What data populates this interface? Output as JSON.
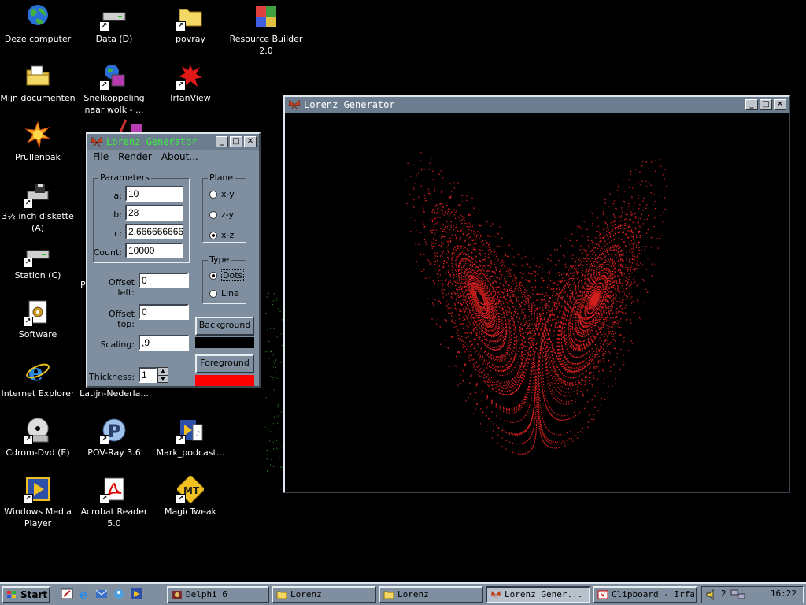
{
  "desktop": {
    "icons": [
      {
        "label": "Deze computer"
      },
      {
        "label": "Mijn documenten"
      },
      {
        "label": "Prullenbak"
      },
      {
        "label": "3½ inch diskette (A)"
      },
      {
        "label": "Station (C)"
      },
      {
        "label": "Software"
      },
      {
        "label": "Internet Explorer"
      },
      {
        "label": "Cdrom-Dvd (E)"
      },
      {
        "label": "Windows Media Player"
      },
      {
        "label": "Data (D)"
      },
      {
        "label": "Snelkoppeling naar wolk - ..."
      },
      {
        "label": "Latijn-Nederla..."
      },
      {
        "label": "POV-Ray 3.6"
      },
      {
        "label": "Acrobat Reader 5.0"
      },
      {
        "label": "povray"
      },
      {
        "label": "IrfanView"
      },
      {
        "label": "Mark_podcast..."
      },
      {
        "label": "MagicTweak"
      },
      {
        "label": "Resource Builder 2.0"
      }
    ],
    "partial_label": "P"
  },
  "small_window": {
    "title": "Lorenz Generator",
    "menu": [
      "File",
      "Render",
      "About..."
    ],
    "parameters_title": "Parameters",
    "a_label": "a:",
    "a_value": "10",
    "b_label": "b:",
    "b_value": "28",
    "c_label": "c:",
    "c_value": "2,666666666",
    "count_label": "Count:",
    "count_value": "10000",
    "offset_left_label": "Offset left:",
    "offset_left_value": "0",
    "offset_top_label": "Offset top:",
    "offset_top_value": "0",
    "scaling_label": "Scaling:",
    "scaling_value": ",9",
    "thickness_label": "Thickness:",
    "thickness_value": "1",
    "plane_title": "Plane",
    "plane_options": [
      "x-y",
      "z-y",
      "x-z"
    ],
    "plane_selected": "x-z",
    "type_title": "Type",
    "type_options": [
      "Dots",
      "Line"
    ],
    "type_selected": "Dots",
    "background_button": "Background",
    "foreground_button": "Foreground",
    "background_color": "#000000",
    "foreground_color": "#ff0000"
  },
  "render_window": {
    "title": "Lorenz Generator",
    "plot_color": "#d42020",
    "background": "#000000"
  },
  "taskbar": {
    "start_label": "Start",
    "items": [
      {
        "label": "Delphi 6",
        "active": false
      },
      {
        "label": "Lorenz",
        "active": false
      },
      {
        "label": "Lorenz",
        "active": false
      },
      {
        "label": "Lorenz Gener...",
        "active": true
      },
      {
        "label": "Clipboard - Irfan...",
        "active": false
      }
    ],
    "tray_number": "2",
    "clock": "16:22"
  }
}
